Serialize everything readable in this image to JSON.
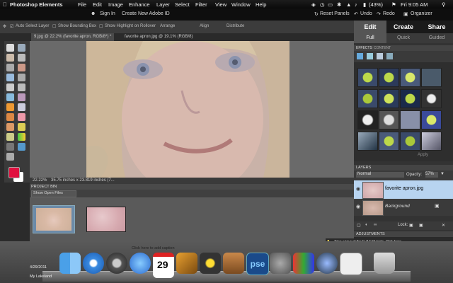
{
  "menubar": {
    "apple_icon": "apple-icon",
    "app_name": "Photoshop Elements",
    "items": [
      "File",
      "Edit",
      "Image",
      "Enhance",
      "Layer",
      "Select",
      "Filter",
      "View",
      "Window",
      "Help"
    ],
    "battery": "(43%)",
    "clock": "Fri 9:05 AM"
  },
  "appbar": {
    "sign_in": "Sign In",
    "create_id": "Create New Adobe ID",
    "reset_panels": "Reset Panels",
    "undo": "Undo",
    "redo": "Redo",
    "organizer": "Organizer"
  },
  "optionsbar": {
    "auto_select": "Auto Select Layer",
    "bounding_box": "Show Bounding Box",
    "highlight": "Show Highlight on Rollover",
    "arrange": "Arrange",
    "align": "Align",
    "distribute": "Distribute"
  },
  "doc_tabs": [
    "9.jpg @ 22.2% (favorite apron, RGB/8*) *",
    "favorite apron.jpg @ 19.1% (RGB/8)"
  ],
  "status": {
    "zoom": "22.22%",
    "dims": "35.75 inches x 23.819 inches (7..."
  },
  "project_bin": {
    "title": "PROJECT BIN",
    "filter": "Show Open Files"
  },
  "right_panel": {
    "tabs": [
      "Edit",
      "Create",
      "Share"
    ],
    "subtabs": [
      "Full",
      "Quick",
      "Guided"
    ],
    "effects_tabs": [
      "EFFECTS",
      "CONTENT"
    ],
    "apply": "Apply",
    "layers_title": "LAYERS",
    "blend_mode": "Normal",
    "opacity_label": "Opacity:",
    "opacity_value": "57%",
    "layers": [
      {
        "name": "favorite apron.jpg"
      },
      {
        "name": "Background"
      }
    ],
    "lock_label": "Lock:",
    "adjustments": "ADJUSTMENTS"
  },
  "tip": "Take a tour of the Full Edit tools. Click here.",
  "caption_hint": "Click here to add caption",
  "desktop_text": [
    "4/29/2011",
    "My Lakeland"
  ],
  "calendar_day": "29",
  "dock_icons": [
    "finder-icon",
    "safari-icon",
    "chrome-icon",
    "itunes-icon",
    "ical-icon",
    "garageband-icon",
    "imovie-icon",
    "keynote-icon",
    "pse-icon",
    "sysprefs-icon",
    "iphoto-icon",
    "ipen-icon",
    "dashboard-icon",
    "trash-icon"
  ],
  "colors": {
    "foreground": "#e0103f",
    "background": "#ffffff",
    "selected_layer": "#b8d4f0"
  }
}
